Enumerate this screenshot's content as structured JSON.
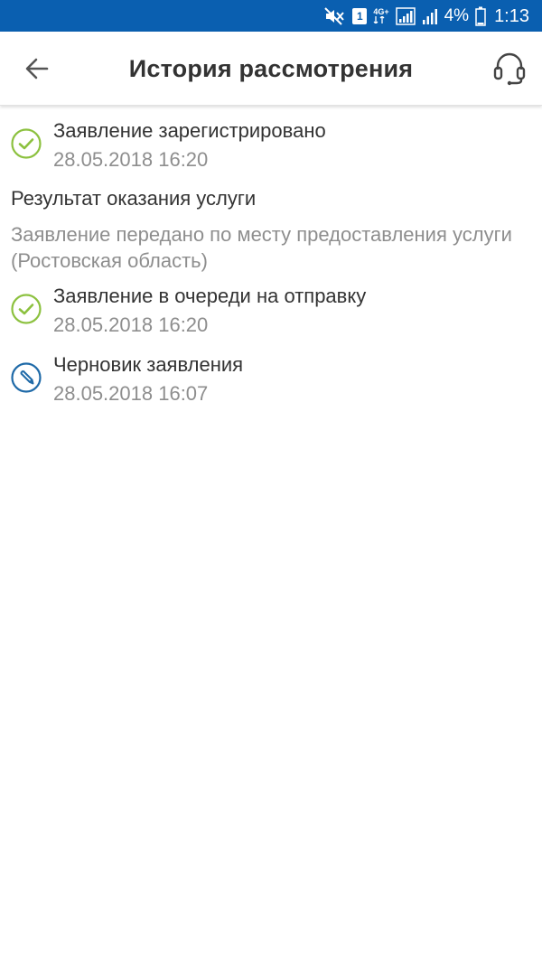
{
  "status_bar": {
    "network_label": "4G+",
    "battery_percent": "4%",
    "time": "1:13",
    "notification_badge": "1",
    "icons": [
      "mute-icon",
      "notification-badge-icon",
      "signal-4g-icon",
      "signal-icon",
      "battery-icon"
    ]
  },
  "header": {
    "title": "История рассмотрения",
    "back_icon": "arrow-left-icon",
    "support_icon": "headset-icon"
  },
  "colors": {
    "status_bar_bg": "#0a5fb0",
    "success": "#8cc13f",
    "draft": "#1f6aa8",
    "text_primary": "#333333",
    "text_secondary": "#8e8e8e"
  },
  "history": [
    {
      "title": "Заявление зарегистрировано",
      "date": "28.05.2018 16:20",
      "icon": "check-circle-icon"
    },
    {
      "title": "Заявление в очереди на отправку",
      "date": "28.05.2018 16:20",
      "icon": "check-circle-icon"
    },
    {
      "title": "Черновик заявления",
      "date": "28.05.2018 16:07",
      "icon": "pencil-circle-icon"
    }
  ],
  "result": {
    "title": "Результат оказания услуги",
    "text": "Заявление передано по месту предоставления услуги (Ростовская область)"
  }
}
